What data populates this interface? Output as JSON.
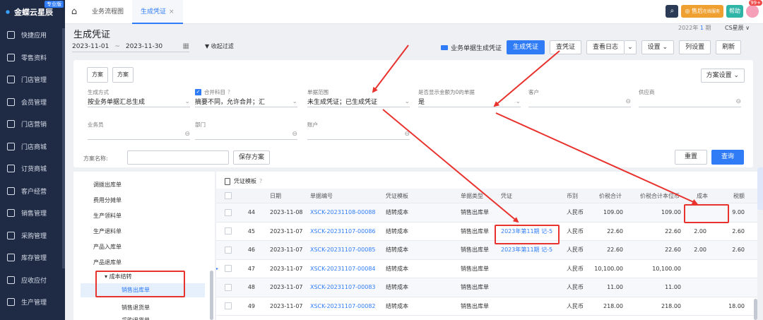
{
  "app": {
    "logo": "金蝶云星辰",
    "edition": "专业版"
  },
  "sidebar": {
    "items": [
      {
        "label": "快捷应用",
        "icon": "grid-icon"
      },
      {
        "label": "零售资料",
        "icon": "store-icon"
      },
      {
        "label": "门店管理",
        "icon": "shop-icon"
      },
      {
        "label": "会员管理",
        "icon": "heart-icon"
      },
      {
        "label": "门店营销",
        "icon": "marketing-icon"
      },
      {
        "label": "门店商城",
        "icon": "mall-icon"
      },
      {
        "label": "订货商城",
        "icon": "order-mall-icon"
      },
      {
        "label": "客户经营",
        "icon": "customer-icon"
      },
      {
        "label": "销售管理",
        "icon": "sales-icon"
      },
      {
        "label": "采购管理",
        "icon": "cart-icon"
      },
      {
        "label": "库存管理",
        "icon": "inventory-icon"
      },
      {
        "label": "应收应付",
        "icon": "money-icon"
      },
      {
        "label": "生产管理",
        "icon": "production-icon"
      }
    ]
  },
  "topbar": {
    "tabs": [
      {
        "label": "业务流程图"
      },
      {
        "label": "生成凭证",
        "close": "×"
      }
    ],
    "service_label": "售后",
    "service_sub": "在线服务",
    "help_label": "帮助",
    "badge": "99+"
  },
  "header": {
    "title": "生成凭证",
    "period_prefix": "2022年",
    "period_num": "1",
    "period_suffix": "期",
    "company": "CS星辰 ∨",
    "date_from": "2023-11-01",
    "date_sep": "~",
    "date_to": "2023-11-30",
    "filter_toggle": "收起过滤"
  },
  "toolbar": {
    "biz_generate": "业务单据生成凭证",
    "generate": "生成凭证",
    "view_voucher": "查凭证",
    "view_log": "查看日志",
    "settings": "设置",
    "column_settings": "列设置",
    "refresh": "刷新"
  },
  "filter": {
    "scheme_btn_1": "方案",
    "scheme_btn_2": "方案",
    "scheme_settings": "方案设置",
    "generate_mode_label": "生成方式",
    "generate_mode_value": "按业务单据汇总生成",
    "merge_label": "合并科目",
    "merge_value": "摘要不同，允许合并；汇",
    "range_label": "单据范围",
    "range_value": "未生成凭证；已生成凭证",
    "zero_label": "是否显示金额为0的单据",
    "zero_value": "是",
    "customer_label": "客户",
    "supplier_label": "供应商",
    "salesman_label": "业务员",
    "department_label": "部门",
    "account_label": "账户",
    "scheme_name_label": "方案名称:",
    "save_scheme": "保存方案",
    "reset": "重置",
    "query": "查询"
  },
  "tree": {
    "items": [
      "调拨出库单",
      "费用分摊单",
      "生产领料单",
      "生产退料单",
      "产品入库单",
      "产品退库单"
    ],
    "group": "成本结转",
    "sub_items": [
      "销售出库单",
      "销售退货单",
      "采购退货单"
    ]
  },
  "grid": {
    "template_label": "凭证模板",
    "columns": [
      "日期",
      "单据编号",
      "凭证模板",
      "单据类型",
      "凭证",
      "币别",
      "价税合计",
      "价税合计本位币",
      "成本",
      "税额"
    ],
    "rows": [
      {
        "no": "44",
        "date": "2023-11-08",
        "bill": "XSCK-20231108-00088",
        "tpl": "结转成本",
        "type": "销售出库单",
        "voucher": "",
        "cur": "人民币",
        "total": "109.00",
        "total_base": "109.00",
        "cost": "",
        "tax": "9.00"
      },
      {
        "no": "45",
        "date": "2023-11-07",
        "bill": "XSCK-20231107-00086",
        "tpl": "结转成本",
        "type": "销售出库单",
        "voucher": "2023年第11期 记-5",
        "cur": "人民币",
        "total": "22.60",
        "total_base": "22.60",
        "cost": "2.00",
        "tax": "2.60"
      },
      {
        "no": "46",
        "date": "2023-11-07",
        "bill": "XSCK-20231107-00085",
        "tpl": "结转成本",
        "type": "销售出库单",
        "voucher": "2023年第11期 记-5",
        "cur": "人民币",
        "total": "22.60",
        "total_base": "22.60",
        "cost": "2.00",
        "tax": "2.60"
      },
      {
        "no": "47",
        "date": "2023-11-07",
        "bill": "XSCK-20231107-00084",
        "tpl": "结转成本",
        "type": "销售出库单",
        "voucher": "",
        "cur": "人民币",
        "total": "10,100.00",
        "total_base": "10,100.00",
        "cost": "",
        "tax": ""
      },
      {
        "no": "48",
        "date": "2023-11-07",
        "bill": "XSCK-20231107-00083",
        "tpl": "结转成本",
        "type": "销售出库单",
        "voucher": "",
        "cur": "人民币",
        "total": "11.00",
        "total_base": "11.00",
        "cost": "",
        "tax": ""
      },
      {
        "no": "49",
        "date": "2023-11-07",
        "bill": "XSCK-20231107-00082",
        "tpl": "结转成本",
        "type": "销售出库单",
        "voucher": "",
        "cur": "人民币",
        "total": "218.00",
        "total_base": "218.00",
        "cost": "",
        "tax": "18.00"
      }
    ]
  },
  "colors": {
    "accent": "#2f7cf6",
    "sidebar": "#1f2a44",
    "annotation": "#e8322e"
  }
}
